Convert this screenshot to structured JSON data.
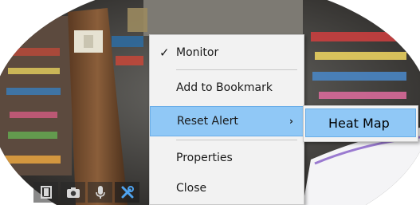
{
  "context_menu": {
    "items": [
      {
        "label": "Monitor",
        "checked": true
      },
      {
        "label": "Add to Bookmark"
      },
      {
        "label": "Reset Alert",
        "highlighted": true,
        "has_submenu": true
      },
      {
        "label": "Properties"
      },
      {
        "label": "Close"
      }
    ],
    "check_glyph": "✓",
    "submenu_arrow": "›"
  },
  "submenu": {
    "items": [
      {
        "label": "Heat Map",
        "highlighted": true
      }
    ]
  },
  "toolbar": {
    "buttons": [
      {
        "icon": "film-icon"
      },
      {
        "icon": "camera-icon"
      },
      {
        "icon": "microphone-icon"
      },
      {
        "icon": "tools-icon",
        "active": true
      }
    ]
  },
  "colors": {
    "highlight": "#90c8f6",
    "menu_background": "#f2f2f2",
    "tool_icon_active": "#4ea3ef"
  }
}
